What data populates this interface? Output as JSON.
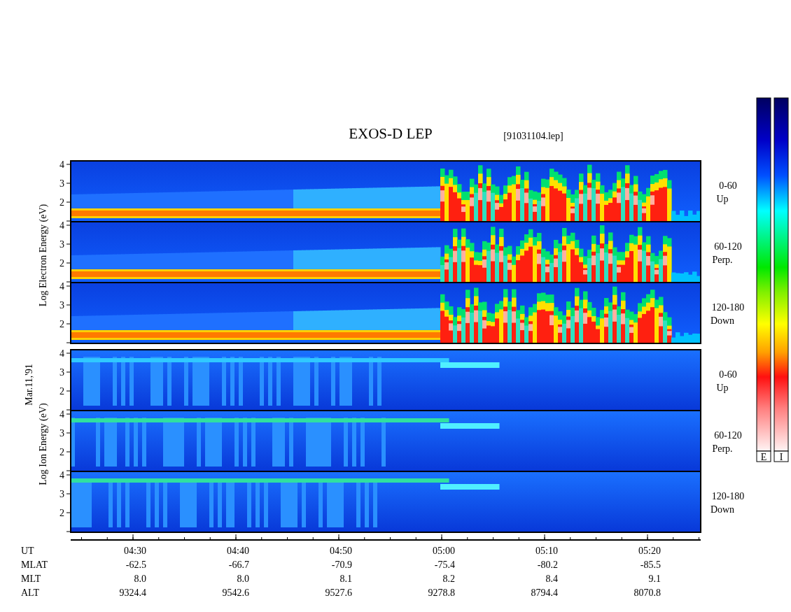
{
  "title": "EXOS-D LEP",
  "file": "[91031104.lep]",
  "date": "Mar.11,'91",
  "groups": [
    {
      "kind": "electron",
      "ylabel": "Log Electron Energy (eV)",
      "panels": [
        {
          "yticks": [
            "4",
            "3",
            "2"
          ],
          "angle": "0-60",
          "direction": "Up"
        },
        {
          "yticks": [
            "4",
            "3",
            "2"
          ],
          "angle": "60-120",
          "direction": "Perp."
        },
        {
          "yticks": [
            "4",
            "3",
            "2"
          ],
          "angle": "120-180",
          "direction": "Down"
        }
      ]
    },
    {
      "kind": "ion",
      "ylabel": "Log Ion Energy (eV)",
      "panels": [
        {
          "yticks": [
            "4",
            "3",
            "2"
          ],
          "angle": "0-60",
          "direction": "Up"
        },
        {
          "yticks": [
            "4",
            "3",
            "2"
          ],
          "angle": "60-120",
          "direction": "Perp."
        },
        {
          "yticks": [
            "4",
            "3",
            "2"
          ],
          "angle": "120-180",
          "direction": "Down"
        }
      ]
    }
  ],
  "color_scales": [
    {
      "label": "E"
    },
    {
      "label": "I"
    }
  ],
  "time_axis": {
    "rows": [
      {
        "label": "UT",
        "values": [
          "04:30",
          "04:40",
          "04:50",
          "05:00",
          "05:10",
          "05:20"
        ]
      },
      {
        "label": "MLAT",
        "values": [
          "-62.5",
          "-66.7",
          "-70.9",
          "-75.4",
          "-80.2",
          "-85.5"
        ]
      },
      {
        "label": "MLT",
        "values": [
          "8.0",
          "8.0",
          "8.1",
          "8.2",
          "8.4",
          "9.1"
        ]
      },
      {
        "label": "ALT",
        "values": [
          "9324.4",
          "9542.6",
          "9527.6",
          "9278.8",
          "8794.4",
          "8070.8"
        ]
      }
    ]
  }
}
